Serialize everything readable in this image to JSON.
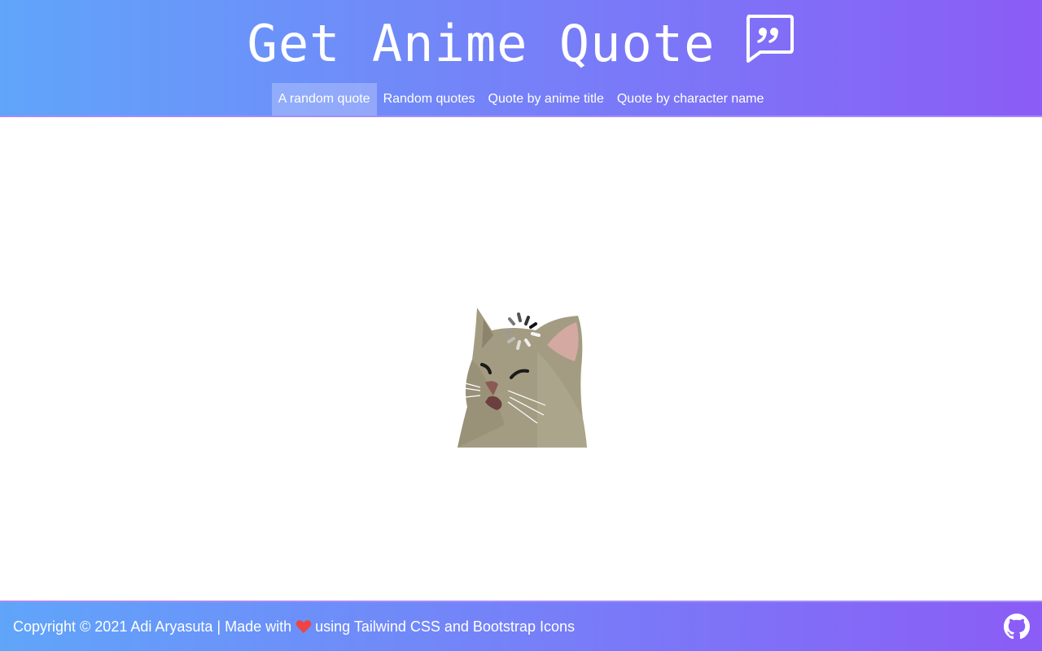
{
  "header": {
    "title": "Get Anime Quote",
    "icon": "chat-quote-icon",
    "gradient": [
      "#60a5fa",
      "#8b5cf6"
    ]
  },
  "nav": {
    "items": [
      {
        "label": "A random quote",
        "active": true
      },
      {
        "label": "Random quotes",
        "active": false
      },
      {
        "label": "Quote by anime title",
        "active": false
      },
      {
        "label": "Quote by character name",
        "active": false
      }
    ]
  },
  "main": {
    "loading_image": "loading-cat-image"
  },
  "footer": {
    "text_before": "Copyright © 2021 Adi Aryasuta | Made with",
    "text_after": "using Tailwind CSS and Bootstrap Icons",
    "heart_color": "#ef4444",
    "icon": "github-icon"
  }
}
